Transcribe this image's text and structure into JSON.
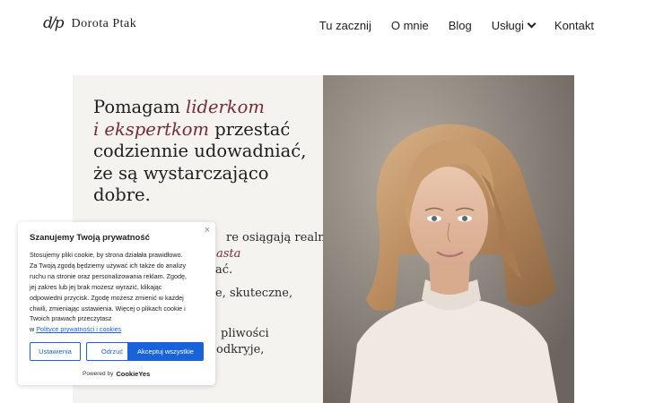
{
  "header": {
    "logo_mark": "d/p",
    "logo_name": "Dorota Ptak",
    "nav": [
      "Tu zacznij",
      "O mnie",
      "Blog",
      "Usługi",
      "Kontakt"
    ]
  },
  "hero": {
    "headline": {
      "line1_plain": "Pomagam ",
      "line1_em": "liderkom",
      "line2_em": "i ekspertkom",
      "line2_plain": " przestać",
      "line3": "codziennie udowadniać,",
      "line4": "że są wystarczająco",
      "line5": "dobre."
    },
    "body_fragments": [
      "re osiągają realne",
      "asta",
      "ać.",
      "e, skuteczne,",
      "pliwości",
      "odkryje,"
    ]
  },
  "cookie_banner": {
    "close_icon": "close-icon",
    "title": "Szanujemy Twoją prywatność",
    "text_lines": [
      "Stosujemy pliki cookie, by strona działała prawidłowo.",
      "Za Twoją zgodą będziemy używać ich także do analizy",
      "ruchu na stronie oraz personalizowania reklam. Zgodę,",
      "jej zakres lub jej brak możesz wyrazić, klikając",
      "odpowiedni przycisk. Zgodę możesz zmienić w każdej",
      "chwili, zmieniając ustawienia. Więcej o plikach cookie i",
      "Twoich prawach przeczytasz"
    ],
    "link_prefix": "w ",
    "link_text": "Polityce prywatności i cookies",
    "buttons": {
      "settings": "Ustawienia",
      "reject": "Odrzuć",
      "accept": "Akceptuj wszystkie"
    },
    "powered_by": "Powered by",
    "powered_brand": "CookieYes"
  },
  "colors": {
    "accent": "#7a2a35",
    "cookie_blue": "#1863dc",
    "hero_left_bg": "#f4f3f0"
  }
}
